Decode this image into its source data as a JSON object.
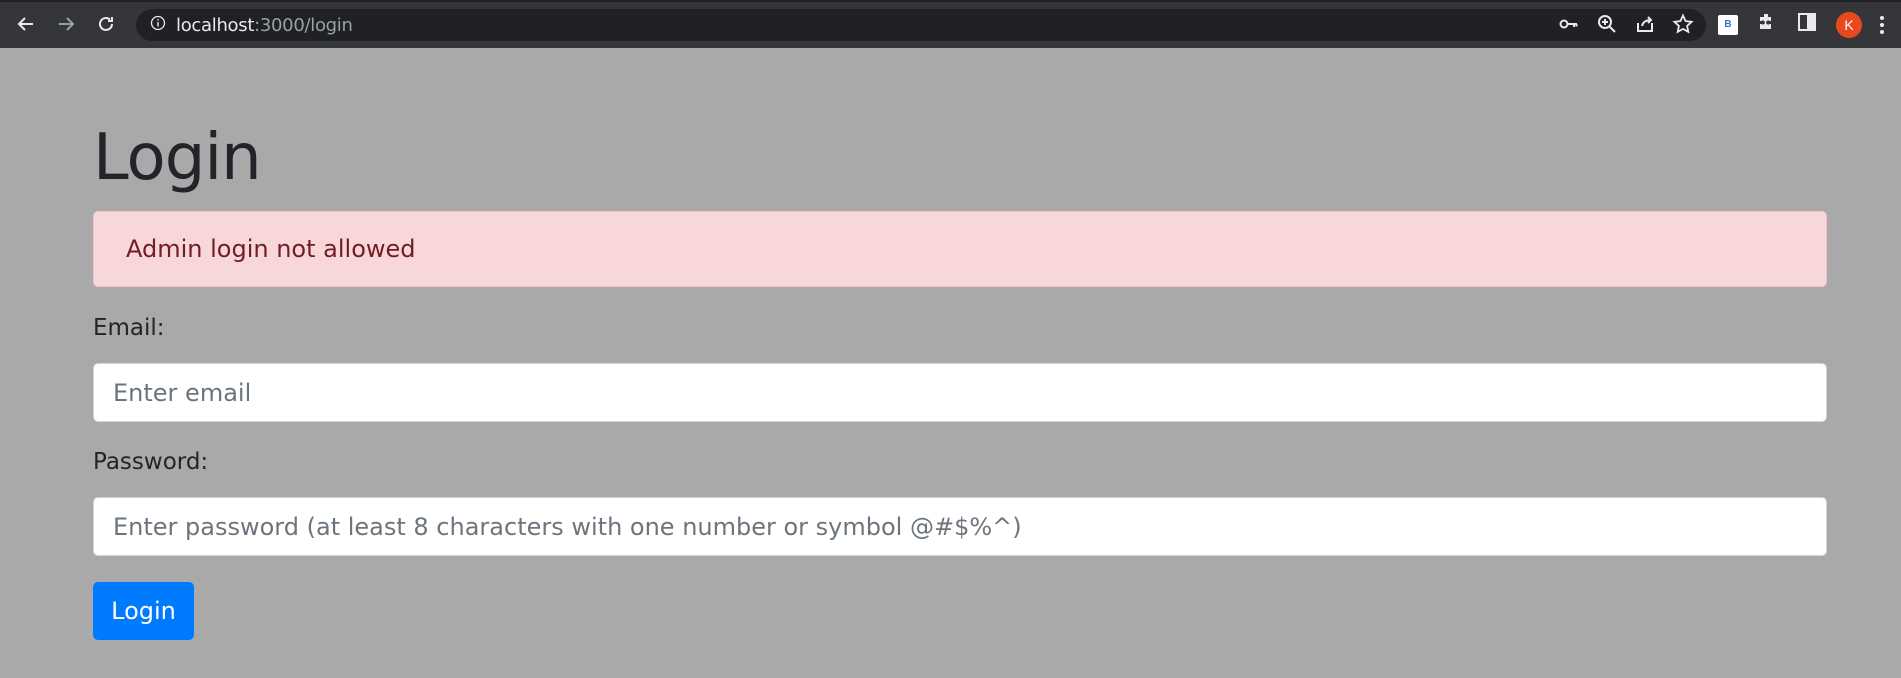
{
  "browser": {
    "url_host": "localhost",
    "url_path": ":3000/login",
    "extension_label": "B",
    "avatar_initial": "K"
  },
  "page": {
    "title": "Login",
    "alert": "Admin login not allowed",
    "email_label": "Email:",
    "email_placeholder": "Enter email",
    "password_label": "Password:",
    "password_placeholder": "Enter password (at least 8 characters with one number or symbol @#$%^)",
    "login_button": "Login"
  },
  "colors": {
    "background": "#a9a9a9",
    "alert_bg": "#f8d7da",
    "alert_text": "#721c24",
    "primary": "#007bff",
    "avatar": "#e8481e"
  },
  "icons": [
    "back-icon",
    "forward-icon",
    "reload-icon",
    "info-icon",
    "key-icon",
    "zoom-icon",
    "share-icon",
    "star-icon",
    "extensions-icon",
    "side-panel-icon",
    "menu-icon"
  ]
}
